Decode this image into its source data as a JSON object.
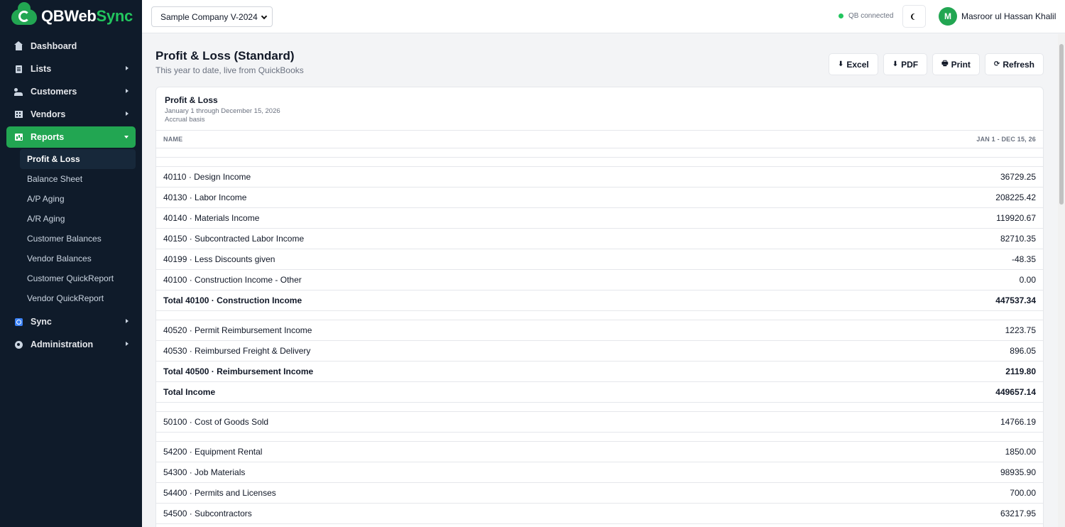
{
  "app": {
    "name_part1": "QBWeb",
    "name_part2": "Sync"
  },
  "sidebar": {
    "items": [
      {
        "label": "Dashboard",
        "icon": "home-icon"
      },
      {
        "label": "Lists",
        "icon": "list-icon"
      },
      {
        "label": "Customers",
        "icon": "people-icon"
      },
      {
        "label": "Vendors",
        "icon": "building-icon"
      },
      {
        "label": "Reports",
        "icon": "chart-icon"
      },
      {
        "label": "Sync",
        "icon": "sync-icon"
      },
      {
        "label": "Administration",
        "icon": "gear-icon"
      }
    ],
    "reports_sub": [
      "Profit & Loss",
      "Balance Sheet",
      "A/P Aging",
      "A/R Aging",
      "Customer Balances",
      "Vendor Balances",
      "Customer QuickReport",
      "Vendor QuickReport"
    ]
  },
  "topbar": {
    "company": "Sample Company V-2024",
    "qb_status": "QB connected",
    "user_initial": "M",
    "user_name": "Masroor ul Hassan Khalil"
  },
  "page": {
    "title": "Profit & Loss (Standard)",
    "subtitle": "This year to date, live from QuickBooks",
    "actions": {
      "excel": "Excel",
      "pdf": "PDF",
      "print": "Print",
      "refresh": "Refresh"
    }
  },
  "report": {
    "title": "Profit & Loss",
    "period": "January 1 through December 15, 2026",
    "basis": "Accrual basis",
    "col_name": "NAME",
    "col_period": "JAN 1 - DEC 15, 26",
    "rows": [
      {
        "type": "blank"
      },
      {
        "type": "blank"
      },
      {
        "name": "40110 · Design Income",
        "value": "36729.25"
      },
      {
        "name": "40130 · Labor Income",
        "value": "208225.42"
      },
      {
        "name": "40140 · Materials Income",
        "value": "119920.67"
      },
      {
        "name": "40150 · Subcontracted Labor Income",
        "value": "82710.35"
      },
      {
        "name": "40199 · Less Discounts given",
        "value": "-48.35"
      },
      {
        "name": "40100 · Construction Income - Other",
        "value": "0.00"
      },
      {
        "name": "Total 40100 · Construction Income",
        "value": "447537.34",
        "type": "total"
      },
      {
        "type": "blank"
      },
      {
        "name": "40520 · Permit Reimbursement Income",
        "value": "1223.75"
      },
      {
        "name": "40530 · Reimbursed Freight & Delivery",
        "value": "896.05"
      },
      {
        "name": "Total 40500 · Reimbursement Income",
        "value": "2119.80",
        "type": "total"
      },
      {
        "name": "Total Income",
        "value": "449657.14",
        "type": "total"
      },
      {
        "type": "blank"
      },
      {
        "name": "50100 · Cost of Goods Sold",
        "value": "14766.19"
      },
      {
        "type": "blank"
      },
      {
        "name": "54200 · Equipment Rental",
        "value": "1850.00"
      },
      {
        "name": "54300 · Job Materials",
        "value": "98935.90"
      },
      {
        "name": "54400 · Permits and Licenses",
        "value": "700.00"
      },
      {
        "name": "54500 · Subcontractors",
        "value": "63217.95"
      }
    ]
  }
}
